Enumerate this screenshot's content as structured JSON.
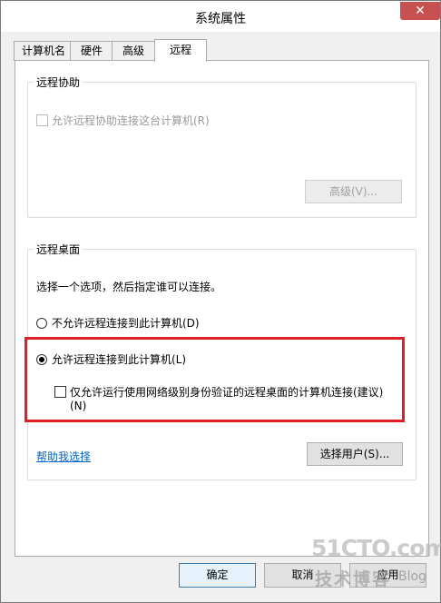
{
  "window": {
    "title": "系统属性",
    "close_glyph": "✕"
  },
  "tabs": [
    {
      "label": "计算机名"
    },
    {
      "label": "硬件"
    },
    {
      "label": "高级"
    },
    {
      "label": "远程",
      "active": true
    }
  ],
  "remote_assistance": {
    "title": "远程协助",
    "allow_label": "允许远程协助连接这台计算机(R)",
    "allow_checked": false,
    "advanced_button": "高级(V)..."
  },
  "remote_desktop": {
    "title": "远程桌面",
    "instruction": "选择一个选项，然后指定谁可以连接。",
    "option_deny": "不允许远程连接到此计算机(D)",
    "option_allow": "允许远程连接到此计算机(L)",
    "selected": "allow",
    "nla_label_line1": "仅允许运行使用网络级别身份验证的远程桌面的计算机连接(建议)",
    "nla_label_line2": "(N)",
    "nla_checked": false,
    "help_link": "帮助我选择",
    "select_users_button": "选择用户(S)..."
  },
  "footer": {
    "ok_button": "确定",
    "cancel_button": "取消",
    "apply_button": "应用"
  },
  "watermark": {
    "line1": "51CTO.com",
    "line2": "技术博客",
    "line3": "Blog"
  },
  "colors": {
    "highlight_box": "#e01e26",
    "link": "#0066cc",
    "close_button": "#c75050"
  }
}
